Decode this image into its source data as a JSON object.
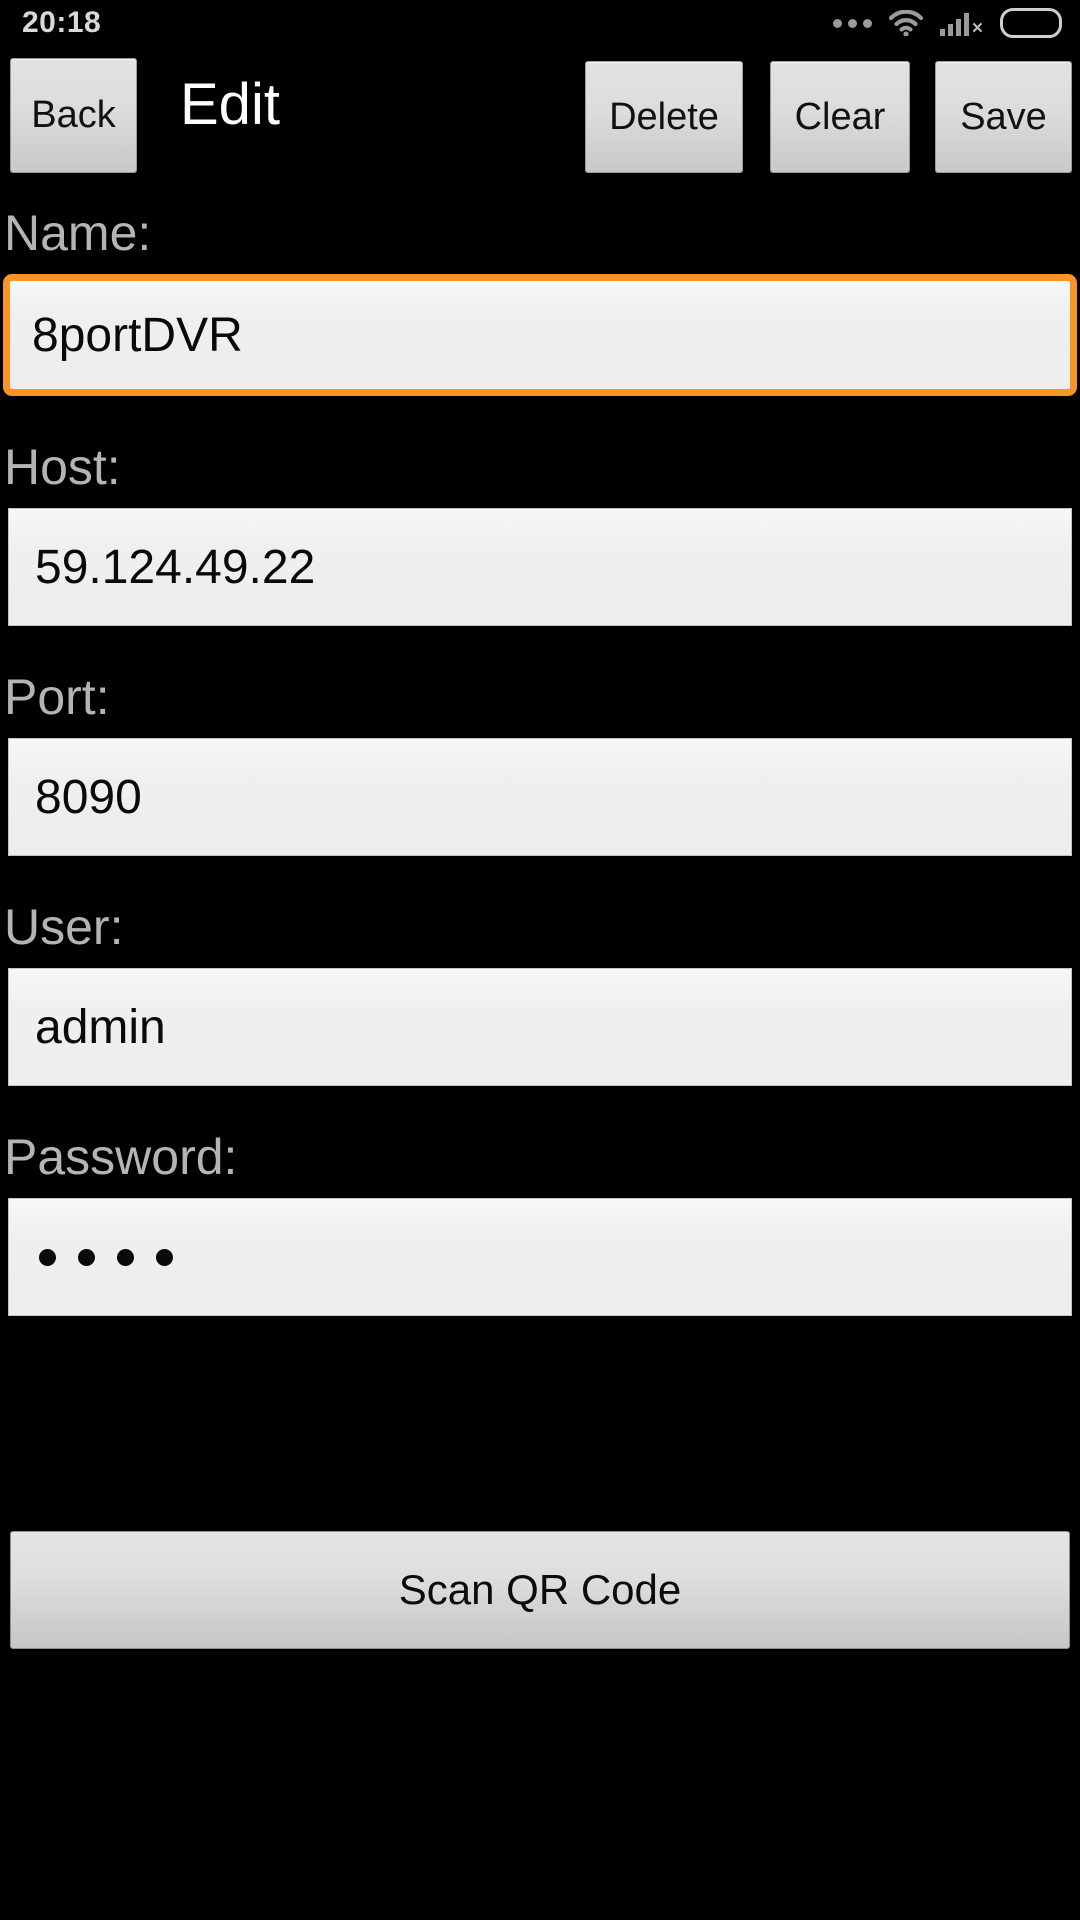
{
  "statusbar": {
    "time": "20:18",
    "icons": {
      "more": "more-dots-icon",
      "wifi": "wifi-icon",
      "cellular": "cellular-signal-icon",
      "cellular_badge": "×",
      "battery": "battery-full-icon"
    },
    "battery_color": "#3fd000"
  },
  "header": {
    "back_label": "Back",
    "title": "Edit",
    "delete_label": "Delete",
    "clear_label": "Clear",
    "save_label": "Save"
  },
  "form": {
    "accent_focus_color": "#f89526",
    "fields": [
      {
        "label": "Name:",
        "value": "8portDVR",
        "focused": true
      },
      {
        "label": "Host:",
        "value": "59.124.49.22",
        "focused": false
      },
      {
        "label": "Port:",
        "value": "8090",
        "focused": false
      },
      {
        "label": "User:",
        "value": "admin",
        "focused": false
      },
      {
        "label": "Password:",
        "value": "• • • •",
        "masked": true,
        "mask_count": 4,
        "focused": false
      }
    ]
  },
  "footer": {
    "scan_label": "Scan QR Code"
  }
}
